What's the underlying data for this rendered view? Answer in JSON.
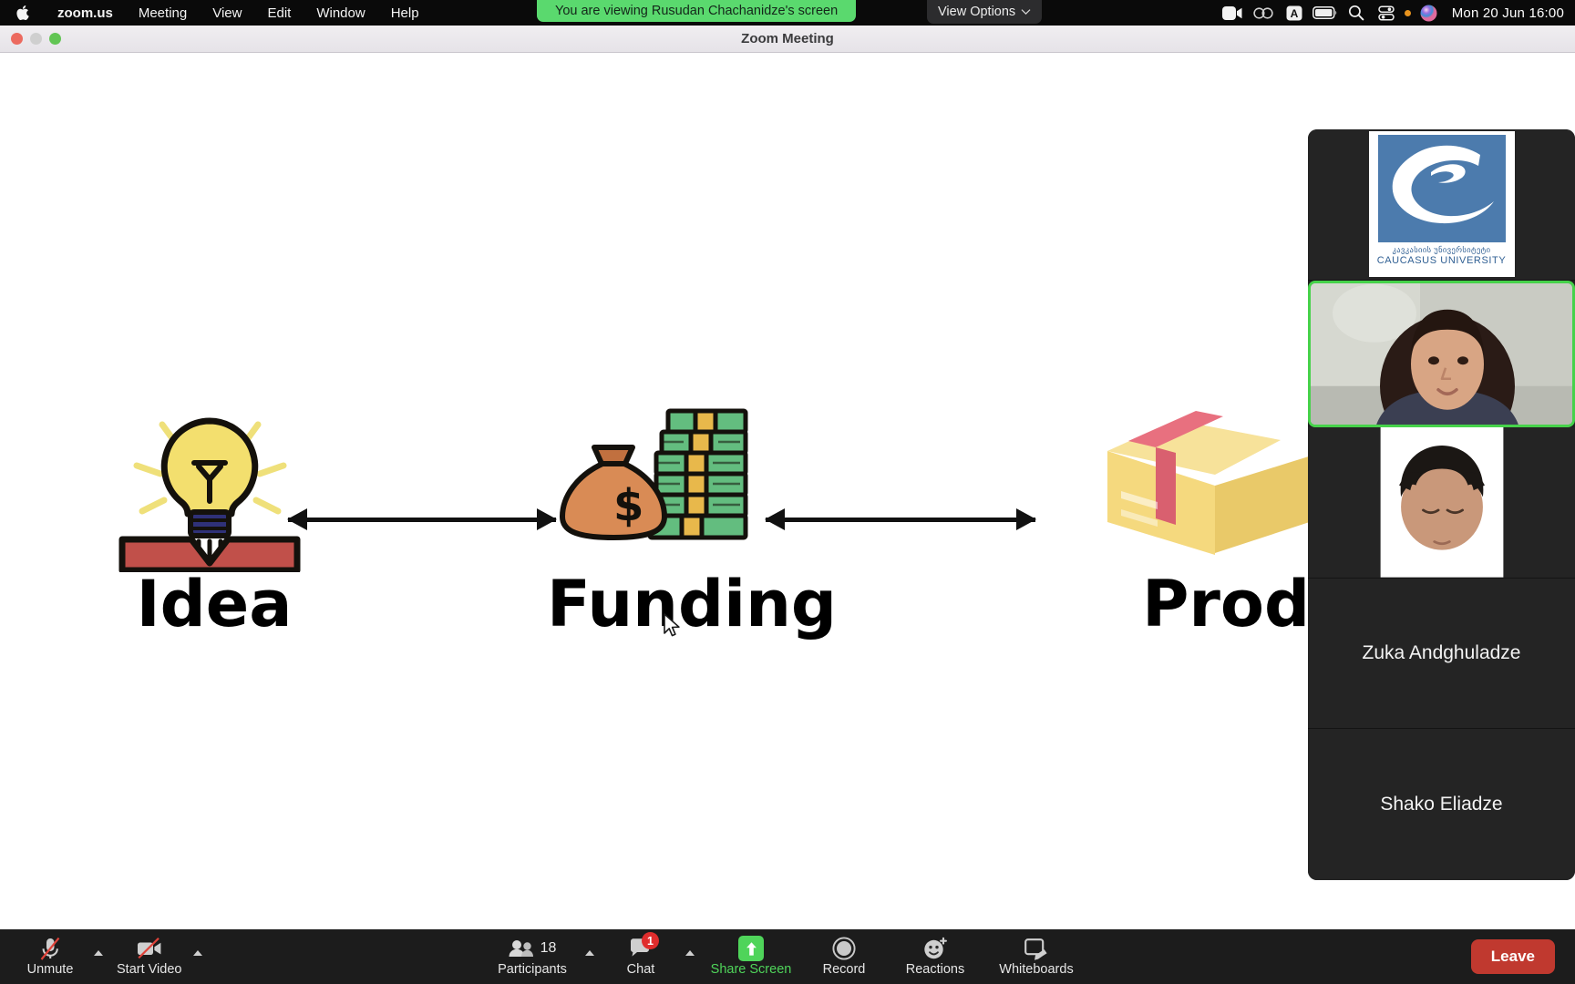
{
  "menubar": {
    "apple_icon": "apple-logo-icon",
    "items": [
      {
        "label": "zoom.us",
        "bold": true
      },
      {
        "label": "Meeting",
        "bold": false
      },
      {
        "label": "View",
        "bold": false
      },
      {
        "label": "Edit",
        "bold": false
      },
      {
        "label": "Window",
        "bold": false
      },
      {
        "label": "Help",
        "bold": false
      }
    ],
    "share_banner": "You are viewing Rusudan Chachanidze's screen",
    "view_options": "View Options",
    "status_icons": [
      "zoom-camera-icon",
      "creative-cloud-icon",
      "input-source-a-icon",
      "battery-icon",
      "spotlight-search-icon",
      "control-center-icon",
      "siri-icon"
    ],
    "clock": "Mon 20 Jun  16:00"
  },
  "window": {
    "title": "Zoom Meeting",
    "traffic_lights": [
      "close-button",
      "minimize-button",
      "zoom-button"
    ]
  },
  "slide": {
    "type": "process-flow-diagram",
    "nodes": [
      {
        "id": "idea",
        "label": "Idea",
        "icon": "lightbulb-icon"
      },
      {
        "id": "funding",
        "label": "Funding",
        "icon": "money-bag-and-cash-icon"
      },
      {
        "id": "product",
        "label": "Produ",
        "icon": "cardboard-box-icon",
        "truncated": true
      }
    ],
    "connectors": [
      {
        "from": "idea",
        "to": "funding",
        "direction": "both"
      },
      {
        "from": "funding",
        "to": "product",
        "direction": "right"
      }
    ],
    "colors": {
      "bulb": "#f3df6e",
      "bulb_base": "#2f3178",
      "bulb_holder": "#c1504a",
      "cash": "#63bd7f",
      "cash_band": "#e8b84b",
      "money_bag": "#d98b55",
      "box": "#f5d97e",
      "box_tape": "#e8707f",
      "arrow": "#111111"
    }
  },
  "filmstrip": {
    "tiles": [
      {
        "kind": "logo",
        "name": "Caucasus University",
        "logo_georgian": "კავკასიის უნივერსიტეტი",
        "logo_english": "CAUCASUS UNIVERSITY",
        "logo_color": "#4c7bad",
        "speaking": false
      },
      {
        "kind": "video",
        "name": "",
        "speaking": true
      },
      {
        "kind": "video",
        "name": "",
        "speaking": false
      },
      {
        "kind": "name",
        "name": "Zuka Andghuladze",
        "speaking": false
      },
      {
        "kind": "name",
        "name": "Shako Eliadze",
        "speaking": false
      }
    ],
    "active_speaker_color": "#46d24a"
  },
  "toolbar": {
    "left": [
      {
        "label": "Unmute",
        "icon": "microphone-muted-icon",
        "has_caret": true
      },
      {
        "label": "Start Video",
        "icon": "camera-off-icon",
        "has_caret": true
      }
    ],
    "center": [
      {
        "label": "Participants",
        "icon": "participants-icon",
        "count": "18",
        "has_caret": true
      },
      {
        "label": "Chat",
        "icon": "chat-bubble-icon",
        "badge": "1",
        "has_caret": true
      },
      {
        "label": "Share Screen",
        "icon": "share-screen-up-arrow-icon",
        "highlight": "#4fd45a"
      },
      {
        "label": "Record",
        "icon": "record-circle-icon"
      },
      {
        "label": "Reactions",
        "icon": "reactions-smiley-plus-icon"
      },
      {
        "label": "Whiteboards",
        "icon": "whiteboard-icon"
      }
    ],
    "leave_label": "Leave",
    "leave_color": "#c0392f"
  }
}
